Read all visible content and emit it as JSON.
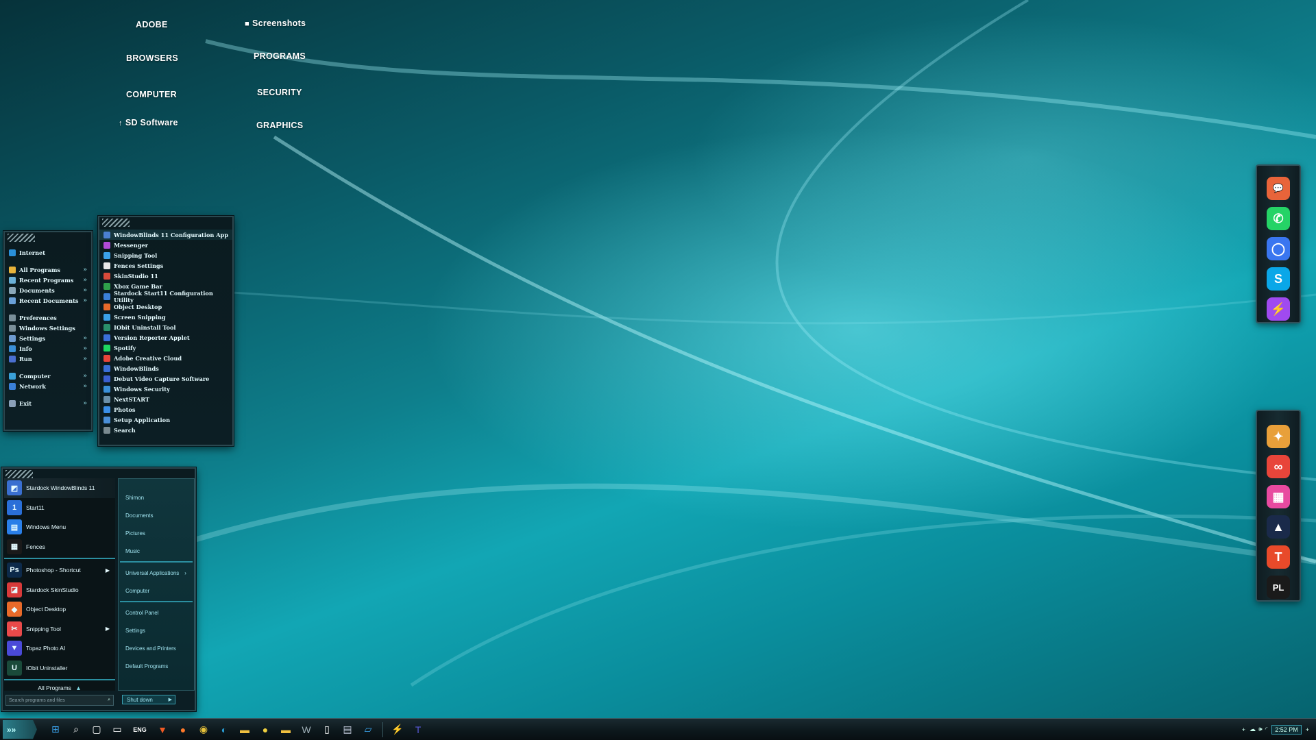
{
  "desktop_labels": {
    "adobe": "ADOBE",
    "screenshots": "Screenshots",
    "browsers": "BROWSERS",
    "programs": "PROGRAMS",
    "computer": "COMPUTER",
    "security": "SECURITY",
    "sd_software": "SD Software",
    "graphics": "GRAPHICS"
  },
  "small_menu": {
    "items": [
      {
        "label": "Internet",
        "icon": "internet-explorer-icon",
        "color": "#2a8fd8"
      },
      {
        "label": "All Programs",
        "icon": "folder-icon",
        "color": "#e8b33a"
      },
      {
        "label": "Recent Programs",
        "icon": "recent-programs-icon",
        "color": "#6bb1d8"
      },
      {
        "label": "Documents",
        "icon": "documents-icon",
        "color": "#8aa7b8"
      },
      {
        "label": "Recent Documents",
        "icon": "recent-documents-icon",
        "color": "#6aa0d8"
      },
      {
        "label": "Preferences",
        "icon": "preferences-icon",
        "color": "#7a8f99"
      },
      {
        "label": "Windows Settings",
        "icon": "windows-settings-icon",
        "color": "#7a8f99"
      },
      {
        "label": "Settings",
        "icon": "settings-icon",
        "color": "#6e9bd0"
      },
      {
        "label": "Info",
        "icon": "info-icon",
        "color": "#3b8fd8"
      },
      {
        "label": "Run",
        "icon": "run-icon",
        "color": "#4a6fd0"
      },
      {
        "label": "Computer",
        "icon": "computer-icon",
        "color": "#3aa0d8"
      },
      {
        "label": "Network",
        "icon": "network-icon",
        "color": "#3a7fd8"
      },
      {
        "label": "Exit",
        "icon": "exit-icon",
        "color": "#8aa0b8"
      }
    ]
  },
  "programs_menu": {
    "items": [
      {
        "label": "WindowBlinds 11 Configuration App",
        "color": "#4a7fd0"
      },
      {
        "label": "Messenger",
        "color": "#b04ad8"
      },
      {
        "label": "Snipping Tool",
        "color": "#3aa0e8"
      },
      {
        "label": "Fences Settings",
        "color": "#e8e8e8"
      },
      {
        "label": "SkinStudio 11",
        "color": "#d84a3a"
      },
      {
        "label": "Xbox Game Bar",
        "color": "#2fa04a"
      },
      {
        "label": "Stardock Start11 Configuration Utility",
        "color": "#3a7fd8"
      },
      {
        "label": "Object Desktop",
        "color": "#e86a2a"
      },
      {
        "label": "Screen Snipping",
        "color": "#3aa0e8"
      },
      {
        "label": "IObit Uninstall Tool",
        "color": "#2a8f6a"
      },
      {
        "label": "Version Reporter Applet",
        "color": "#3a6fd8"
      },
      {
        "label": "Spotify",
        "color": "#1ed760"
      },
      {
        "label": "Adobe Creative Cloud",
        "color": "#e8453a"
      },
      {
        "label": "WindowBlinds",
        "color": "#3a6fd8"
      },
      {
        "label": "Debut Video Capture Software",
        "color": "#3a5fd0"
      },
      {
        "label": "Windows Security",
        "color": "#3a8fd8"
      },
      {
        "label": "NextSTART",
        "color": "#6a8fa8"
      },
      {
        "label": "Photos",
        "color": "#3a8fe8"
      },
      {
        "label": "Setup Application",
        "color": "#4a8fd8"
      },
      {
        "label": "Search",
        "color": "#7a8a90"
      }
    ]
  },
  "start_menu": {
    "left_items": [
      {
        "label": "Stardock WindowBlinds 11",
        "glyph": "◩",
        "color": "#3a6fd0",
        "has_arrow": false
      },
      {
        "label": "Start11",
        "glyph": "1",
        "color": "#2a6fd8",
        "has_arrow": false
      },
      {
        "label": "Windows Menu",
        "glyph": "▤",
        "color": "#2a7fe8",
        "has_arrow": false
      },
      {
        "label": "Fences",
        "glyph": "▦",
        "color": "#1a1a1a",
        "has_arrow": false
      },
      {
        "label": "Photoshop - Shortcut",
        "glyph": "Ps",
        "color": "#0d2a4a",
        "has_arrow": true
      },
      {
        "label": "Stardock SkinStudio",
        "glyph": "◪",
        "color": "#d83a3a",
        "has_arrow": false
      },
      {
        "label": "Object Desktop",
        "glyph": "◆",
        "color": "#e86a2a",
        "has_arrow": false
      },
      {
        "label": "Snipping Tool",
        "glyph": "✂",
        "color": "#e84a4a",
        "has_arrow": true
      },
      {
        "label": "Topaz Photo AI",
        "glyph": "▼",
        "color": "#4a4ad8",
        "has_arrow": false
      },
      {
        "label": "IObit Uninstaller",
        "glyph": "U",
        "color": "#1a4a3a",
        "has_arrow": false
      }
    ],
    "all_programs": "All Programs",
    "search_placeholder": "Search programs and files",
    "right_items_1": [
      "Shimon",
      "Documents",
      "Pictures",
      "Music"
    ],
    "right_items_2": [
      "Universal Applications",
      "Computer"
    ],
    "right_items_3": [
      "Control Panel",
      "Settings",
      "Devices and Printers",
      "Default Programs"
    ],
    "shutdown": "Shut down"
  },
  "dock_top": {
    "icons": [
      {
        "name": "chat-bubbles-icon",
        "glyph": "💬",
        "color": "#e8643a"
      },
      {
        "name": "whatsapp-icon",
        "glyph": "✆",
        "color": "#25d366"
      },
      {
        "name": "signal-icon",
        "glyph": "◯",
        "color": "#3a76f0"
      },
      {
        "name": "skype-icon",
        "glyph": "S",
        "color": "#0aa7e8"
      },
      {
        "name": "messenger-icon",
        "glyph": "⚡",
        "color": "#a04af0"
      }
    ]
  },
  "dock_bottom": {
    "icons": [
      {
        "name": "pinwheel-icon",
        "glyph": "✦",
        "color": "#e8a03a"
      },
      {
        "name": "creative-cloud-icon",
        "glyph": "∞",
        "color": "#e8453a"
      },
      {
        "name": "app-grid-icon",
        "glyph": "▦",
        "color": "#e84aa0"
      },
      {
        "name": "affinity-icon",
        "glyph": "▲",
        "color": "#1a2a4a"
      },
      {
        "name": "topaz-icon",
        "glyph": "T",
        "color": "#e84a2a"
      },
      {
        "name": "dxo-pl-icon",
        "glyph": "PL",
        "color": "#1a1a1a"
      }
    ]
  },
  "taskbar": {
    "language": "ENG",
    "time": "2:52 PM",
    "icons": [
      {
        "name": "windows-start-icon",
        "glyph": "⊞",
        "color": "#3aa0e8"
      },
      {
        "name": "search-icon",
        "glyph": "⌕",
        "color": "#ffffff"
      },
      {
        "name": "task-view-icon",
        "glyph": "▢",
        "color": "#ffffff"
      },
      {
        "name": "chat-icon",
        "glyph": "▭",
        "color": "#ffffff"
      },
      {
        "name": "language-indicator",
        "glyph": "ENG",
        "color": "#ffffff"
      },
      {
        "name": "brave-icon",
        "glyph": "▼",
        "color": "#f05a24"
      },
      {
        "name": "firefox-icon",
        "glyph": "●",
        "color": "#ff7a2a"
      },
      {
        "name": "chrome-icon",
        "glyph": "◉",
        "color": "#e8c33a"
      },
      {
        "name": "edge-icon",
        "glyph": "◐",
        "color": "#2aa0d8"
      },
      {
        "name": "file-explorer-icon",
        "glyph": "▬",
        "color": "#f0c040"
      },
      {
        "name": "paint-icon",
        "glyph": "●",
        "color": "#f0d040"
      },
      {
        "name": "folder-icon",
        "glyph": "▬",
        "color": "#f0c040"
      },
      {
        "name": "wordpad-icon",
        "glyph": "W",
        "color": "#9fb0b8"
      },
      {
        "name": "notepad-icon",
        "glyph": "▯",
        "color": "#ffffff"
      },
      {
        "name": "film-icon",
        "glyph": "▤",
        "color": "#c0c8d8"
      },
      {
        "name": "screen-icon",
        "glyph": "▱",
        "color": "#3aa0e8"
      },
      {
        "name": "messenger-taskbar-icon",
        "glyph": "⚡",
        "color": "#a04af0"
      },
      {
        "name": "teams-icon",
        "glyph": "T",
        "color": "#5a5ad8"
      }
    ]
  }
}
